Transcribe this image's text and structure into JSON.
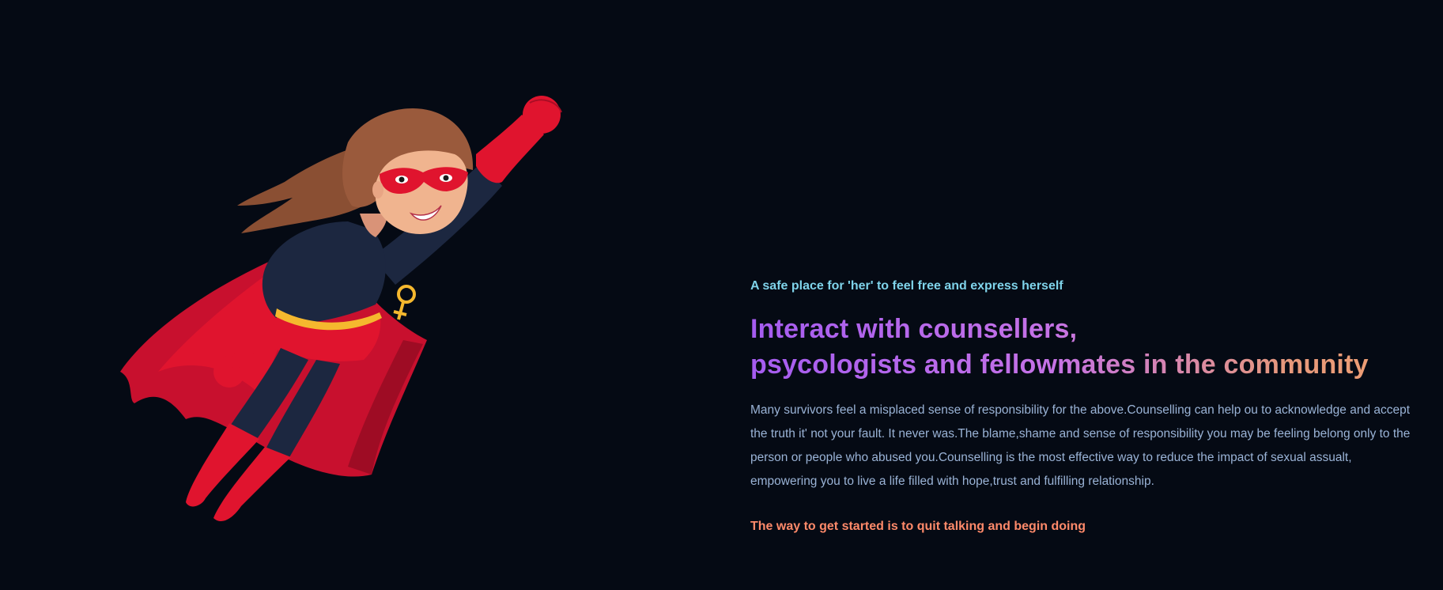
{
  "hero": {
    "illustration": "flying-superheroine-illustration",
    "emblem": "female-symbol-icon"
  },
  "content": {
    "tagline": "A safe place for 'her' to feel free and express herself",
    "headline_line1": "Interact with counsellers,",
    "headline_line2": "psycologists and fellowmates in the community",
    "body": "Many survivors feel a misplaced sense of responsibility for the above.Counselling can help ou to acknowledge and accept the truth it' not your fault. It never was.The blame,shame and sense of responsibility you may be feeling belong only to the person or people who abused you.Counselling is the most effective way to reduce the impact of sexual assualt, empowering you to live a life filled with hope,trust and fulfilling relationship.",
    "quote": "The way to get started is to quit talking and begin doing"
  },
  "colors": {
    "background": "#050a14",
    "tagline": "#7fd3ea",
    "headline_gradient_start": "#a55cf0",
    "headline_gradient_end": "#f0a070",
    "body": "#9ab3d6",
    "quote": "#ff8a6a",
    "cape": "#e0142e",
    "suit": "#1c2740",
    "belt": "#f5b82e",
    "hair": "#9a5a3c"
  }
}
